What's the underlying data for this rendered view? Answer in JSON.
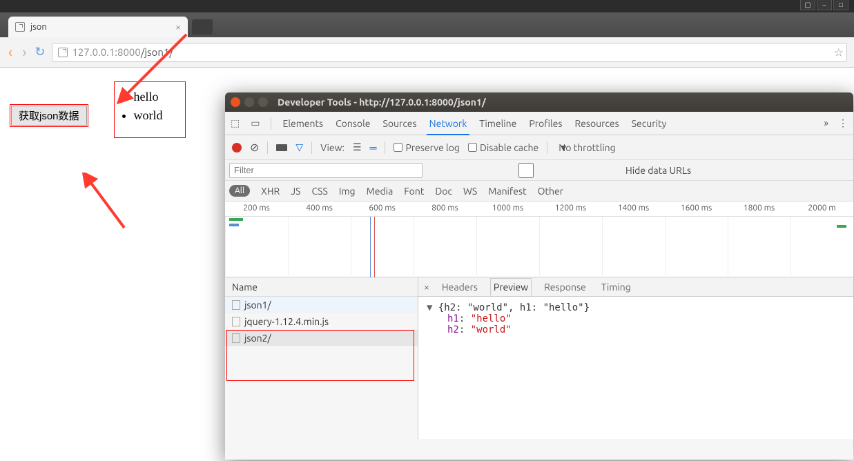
{
  "tab": {
    "title": "json"
  },
  "url": {
    "host": "127.0.0.1:8000",
    "path": "/json1/"
  },
  "page": {
    "button_label": "获取json数据",
    "items": [
      "hello",
      "world"
    ]
  },
  "devtools": {
    "title": "Developer Tools - http://127.0.0.1:8000/json1/",
    "tabs": [
      "Elements",
      "Console",
      "Sources",
      "Network",
      "Timeline",
      "Profiles",
      "Resources",
      "Security"
    ],
    "active_tab": "Network",
    "toolbar": {
      "view_label": "View:",
      "preserve_log": "Preserve log",
      "disable_cache": "Disable cache",
      "throttling": "No throttling"
    },
    "filter": {
      "placeholder": "Filter",
      "hide_urls": "Hide data URLs"
    },
    "types": [
      "All",
      "XHR",
      "JS",
      "CSS",
      "Img",
      "Media",
      "Font",
      "Doc",
      "WS",
      "Manifest",
      "Other"
    ],
    "timeline": [
      "200 ms",
      "400 ms",
      "600 ms",
      "800 ms",
      "1000 ms",
      "1200 ms",
      "1400 ms",
      "1600 ms",
      "1800 ms",
      "2000 m"
    ],
    "name_col": "Name",
    "requests": [
      "json1/",
      "jquery-1.12.4.min.js",
      "json2/"
    ],
    "detail_tabs": [
      "Headers",
      "Preview",
      "Response",
      "Timing"
    ],
    "active_detail_tab": "Preview",
    "preview": {
      "summary": "{h2: \"world\", h1: \"hello\"}",
      "h1_key": "h1",
      "h1_val": "\"hello\"",
      "h2_key": "h2",
      "h2_val": "\"world\""
    }
  }
}
